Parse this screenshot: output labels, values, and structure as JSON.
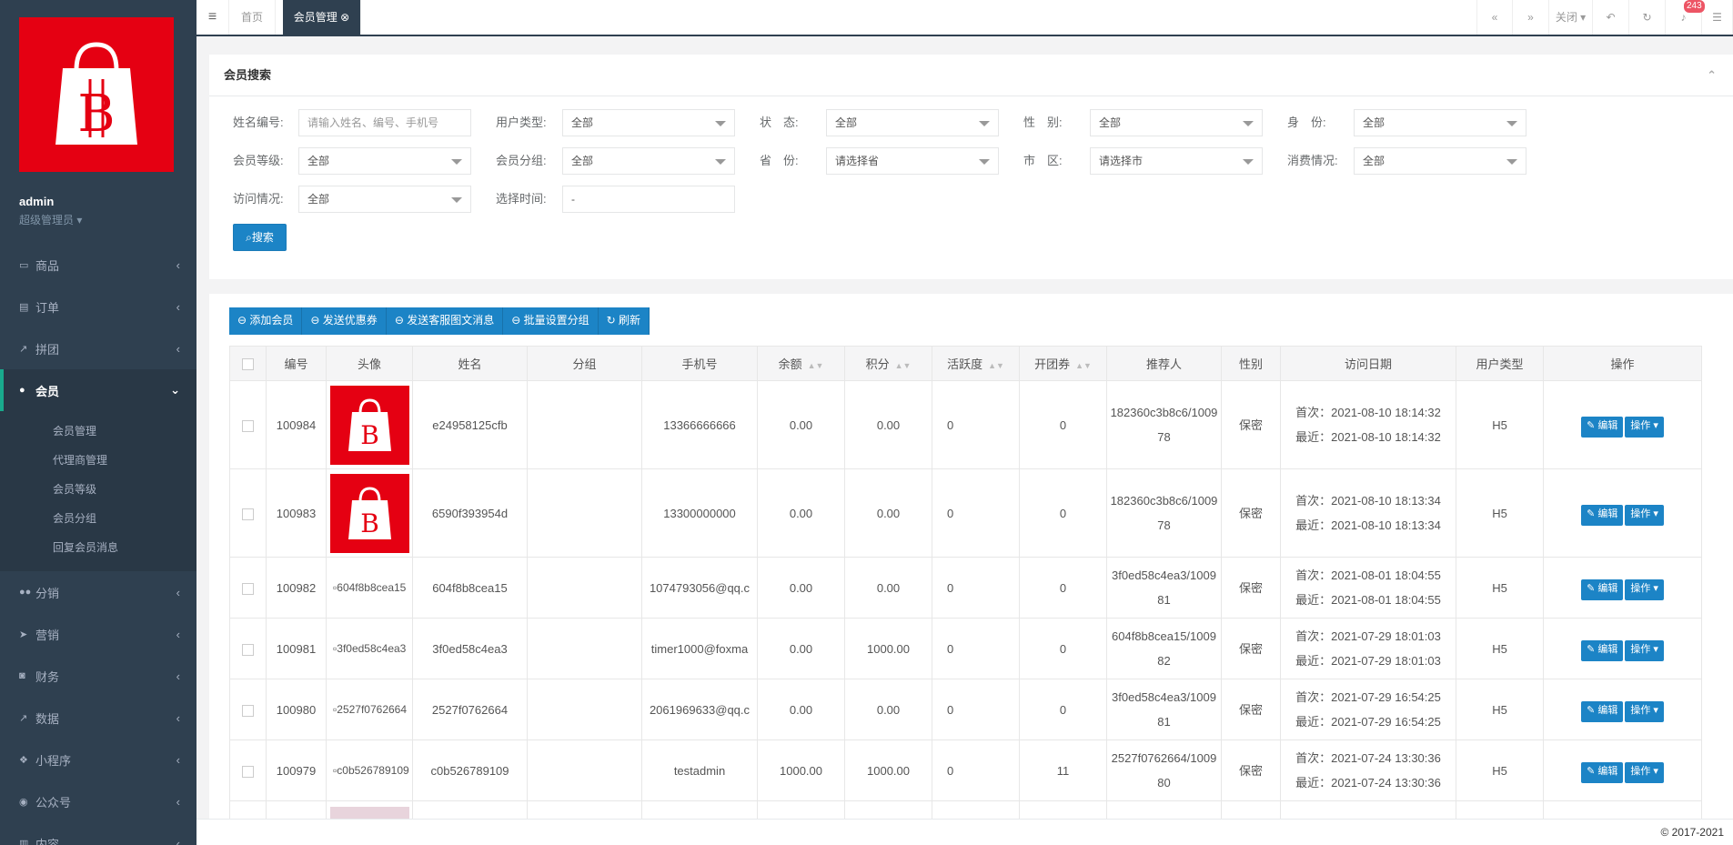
{
  "sidebar": {
    "user_name": "admin",
    "user_role": "超级管理员",
    "items": [
      {
        "label": "商品",
        "icon": "laptop-icon"
      },
      {
        "label": "订单",
        "icon": "file-icon"
      },
      {
        "label": "拼团",
        "icon": "chart-icon"
      },
      {
        "label": "会员",
        "icon": "user-icon"
      },
      {
        "label": "分销",
        "icon": "users-icon"
      },
      {
        "label": "营销",
        "icon": "send-icon"
      },
      {
        "label": "财务",
        "icon": "money-icon"
      },
      {
        "label": "数据",
        "icon": "chart-icon"
      },
      {
        "label": "小程序",
        "icon": "cubes-icon"
      },
      {
        "label": "公众号",
        "icon": "wechat-icon"
      },
      {
        "label": "内容",
        "icon": "book-icon"
      }
    ],
    "sub_items": [
      "会员管理",
      "代理商管理",
      "会员等级",
      "会员分组",
      "回复会员消息"
    ]
  },
  "topbar": {
    "tab_home": "首页",
    "tab_current": "会员管理",
    "close_label": "关闭",
    "notif_count": "243"
  },
  "search": {
    "title": "会员搜索",
    "f1_label": "姓名编号:",
    "f1_placeholder": "请输入姓名、编号、手机号",
    "f2_label": "用户类型:",
    "f2_value": "全部",
    "f3_label": "状　态:",
    "f3_value": "全部",
    "f4_label": "性　别:",
    "f4_value": "全部",
    "f5_label": "身　份:",
    "f5_value": "全部",
    "f6_label": "会员等级:",
    "f6_value": "全部",
    "f7_label": "会员分组:",
    "f7_value": "全部",
    "f8_label": "省　份:",
    "f8_value": "请选择省",
    "f9_label": "市　区:",
    "f9_value": "请选择市",
    "f10_label": "消费情况:",
    "f10_value": "全部",
    "f11_label": "访问情况:",
    "f11_value": "全部",
    "f12_label": "选择时间:",
    "f12_value": " - ",
    "search_btn": "搜索"
  },
  "toolbar": {
    "add": "添加会员",
    "coupon": "发送优惠券",
    "msg": "发送客服图文消息",
    "group": "批量设置分组",
    "refresh": "刷新"
  },
  "table": {
    "headers": [
      "编号",
      "头像",
      "姓名",
      "分组",
      "手机号",
      "余额",
      "积分",
      "活跃度",
      "开团券",
      "推荐人",
      "性别",
      "访问日期",
      "用户类型",
      "操作"
    ],
    "edit_label": "编辑",
    "op_label": "操作",
    "rows": [
      {
        "id": "100984",
        "avatar_alt": "",
        "name": "e24958125cfb",
        "group": "",
        "phone": "13366666666",
        "balance": "0.00",
        "points": "0.00",
        "activity": "0",
        "coupon": "0",
        "referrer": "182360c3b8c6/100978",
        "gender": "保密",
        "first": "首次：2021-08-10 18:14:32",
        "last": "最近：2021-08-10 18:14:32",
        "type": "H5"
      },
      {
        "id": "100983",
        "avatar_alt": "",
        "name": "6590f393954d",
        "group": "",
        "phone": "13300000000",
        "balance": "0.00",
        "points": "0.00",
        "activity": "0",
        "coupon": "0",
        "referrer": "182360c3b8c6/100978",
        "gender": "保密",
        "first": "首次：2021-08-10 18:13:34",
        "last": "最近：2021-08-10 18:13:34",
        "type": "H5"
      },
      {
        "id": "100982",
        "avatar_alt": "604f8b8cea15",
        "name": "604f8b8cea15",
        "group": "",
        "phone": "1074793056@qq.c",
        "balance": "0.00",
        "points": "0.00",
        "activity": "0",
        "coupon": "0",
        "referrer": "3f0ed58c4ea3/100981",
        "gender": "保密",
        "first": "首次：2021-08-01 18:04:55",
        "last": "最近：2021-08-01 18:04:55",
        "type": "H5"
      },
      {
        "id": "100981",
        "avatar_alt": "3f0ed58c4ea3",
        "name": "3f0ed58c4ea3",
        "group": "",
        "phone": "timer1000@foxma",
        "balance": "0.00",
        "points": "1000.00",
        "activity": "0",
        "coupon": "0",
        "referrer": "604f8b8cea15/100982",
        "gender": "保密",
        "first": "首次：2021-07-29 18:01:03",
        "last": "最近：2021-07-29 18:01:03",
        "type": "H5"
      },
      {
        "id": "100980",
        "avatar_alt": "2527f0762664",
        "name": "2527f0762664",
        "group": "",
        "phone": "2061969633@qq.c",
        "balance": "0.00",
        "points": "0.00",
        "activity": "0",
        "coupon": "0",
        "referrer": "3f0ed58c4ea3/100981",
        "gender": "保密",
        "first": "首次：2021-07-29 16:54:25",
        "last": "最近：2021-07-29 16:54:25",
        "type": "H5"
      },
      {
        "id": "100979",
        "avatar_alt": "c0b526789109",
        "name": "c0b526789109",
        "group": "",
        "phone": "testadmin",
        "balance": "1000.00",
        "points": "1000.00",
        "activity": "0",
        "coupon": "11",
        "referrer": "2527f0762664/100980",
        "gender": "保密",
        "first": "首次：2021-07-24 13:30:36",
        "last": "最近：2021-07-24 13:30:36",
        "type": "H5"
      }
    ]
  },
  "footer": {
    "copyright": "© 2017-2021"
  },
  "colors": {
    "sidebar": "#2f4050",
    "primary": "#1c84c6",
    "brand_red": "#e50012"
  }
}
